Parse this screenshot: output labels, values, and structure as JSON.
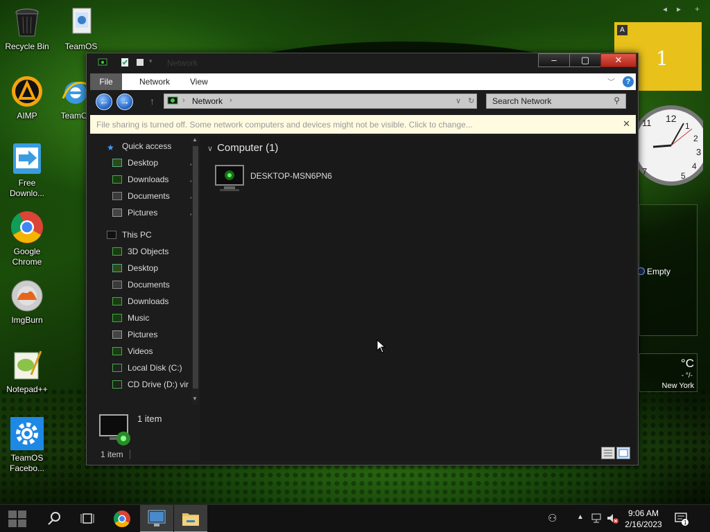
{
  "desktop": {
    "icons": [
      {
        "label": "Recycle Bin"
      },
      {
        "label": "TeamOS"
      },
      {
        "label": "AIMP"
      },
      {
        "label": "TeamO"
      },
      {
        "label": "Free Downlo..."
      },
      {
        "label": "Google Chrome"
      },
      {
        "label": "ImgBurn"
      },
      {
        "label": "Notepad++"
      },
      {
        "label": "TeamOS Facebo..."
      }
    ]
  },
  "widgets": {
    "note_badge": "A",
    "note_number": "1",
    "slideshow_label": "Empty",
    "weather_unit": "°C",
    "weather_value": "- °/-",
    "weather_city": "New York"
  },
  "window": {
    "title": "Network",
    "ribbon_tabs": [
      "File",
      "Network",
      "View"
    ],
    "address_segment": "Network",
    "search_placeholder": "Search Network",
    "info_bar": "File sharing is turned off. Some network computers and devices might not be visible. Click to change...",
    "nav": {
      "quick_access": "Quick access",
      "quick_items": [
        "Desktop",
        "Downloads",
        "Documents",
        "Pictures"
      ],
      "this_pc": "This PC",
      "pc_items": [
        "3D Objects",
        "Desktop",
        "Documents",
        "Downloads",
        "Music",
        "Pictures",
        "Videos",
        "Local Disk (C:)",
        "CD Drive (D:) virt"
      ]
    },
    "group_header": "Computer (1)",
    "computer_name": "DESKTOP-MSN6PN6",
    "details_count": "1 item",
    "status_count": "1 item"
  },
  "taskbar": {
    "time": "9:06 AM",
    "date": "2/16/2023"
  },
  "colors": {
    "note": "#e8c11b",
    "close_button": "#c8392c",
    "accent_blue": "#2f7fd2"
  }
}
